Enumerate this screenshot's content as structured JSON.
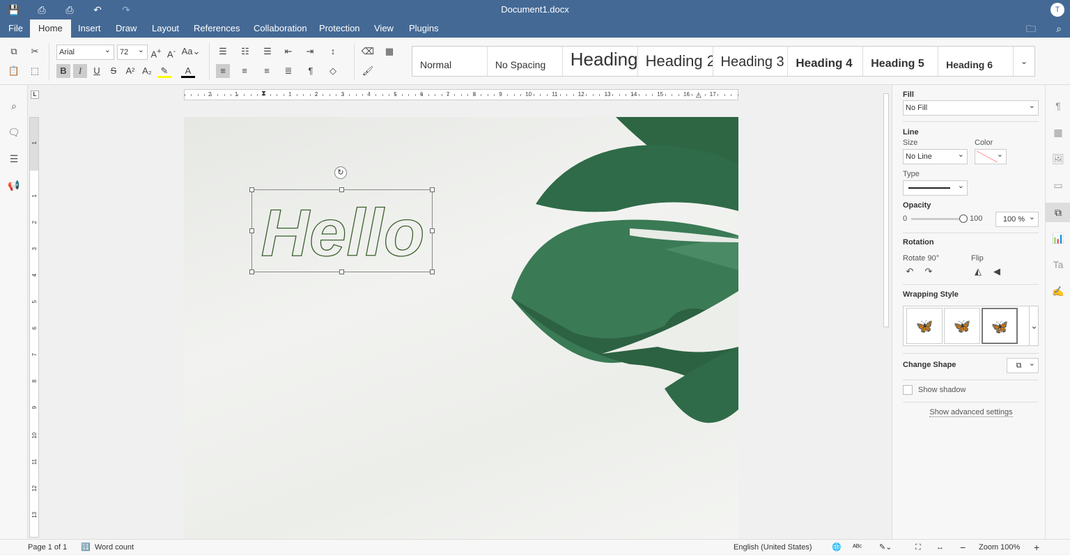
{
  "window": {
    "title": "Document1.docx",
    "user_initial": "T"
  },
  "quick_access": [
    {
      "icon": "save-icon",
      "g": "💾"
    },
    {
      "icon": "print-icon",
      "g": "⎙"
    },
    {
      "icon": "quick-print-icon",
      "g": "⎙"
    },
    {
      "icon": "undo-icon",
      "g": "↶"
    },
    {
      "icon": "redo-icon",
      "g": "↷"
    }
  ],
  "menu": {
    "tabs": [
      "File",
      "Home",
      "Insert",
      "Draw",
      "Layout",
      "References",
      "Collaboration",
      "Protection",
      "View",
      "Plugins"
    ],
    "active": "Home"
  },
  "toolbar": {
    "font": "Arial",
    "size": "72"
  },
  "styles": [
    "Normal",
    "No Spacing",
    "Heading 1",
    "Heading 2",
    "Heading 3",
    "Heading 4",
    "Heading 5",
    "Heading 6"
  ],
  "document": {
    "wordart_text": "Hello"
  },
  "ruler": {
    "h": [
      "2",
      "1",
      "1",
      "2",
      "3",
      "4",
      "5",
      "6",
      "7",
      "8",
      "9",
      "10",
      "11",
      "12",
      "13",
      "14",
      "15",
      "16",
      "17"
    ],
    "v": [
      "1",
      "1",
      "2",
      "3",
      "4",
      "5",
      "6",
      "7",
      "8",
      "9",
      "10",
      "11",
      "12",
      "13"
    ]
  },
  "panel": {
    "fill_label": "Fill",
    "fill_value": "No Fill",
    "line_label": "Line",
    "size_label": "Size",
    "size_value": "No Line",
    "color_label": "Color",
    "type_label": "Type",
    "opacity_label": "Opacity",
    "opacity_min": "0",
    "opacity_max": "100",
    "opacity_value": "100 %",
    "opacity_level": 100,
    "rotation_label": "Rotation",
    "rotate_label": "Rotate 90°",
    "flip_label": "Flip",
    "wrapping_label": "Wrapping Style",
    "change_shape_label": "Change Shape",
    "show_shadow": "Show shadow",
    "show_shadow_checked": false,
    "advanced": "Show advanced settings"
  },
  "status": {
    "page": "Page 1 of 1",
    "word_count": "Word count",
    "language": "English (United States)",
    "zoom": "Zoom 100%"
  },
  "colors": {
    "brand": "#446995",
    "leaf": "#2f6b48",
    "wordart_outline": "#3b5e2b"
  }
}
